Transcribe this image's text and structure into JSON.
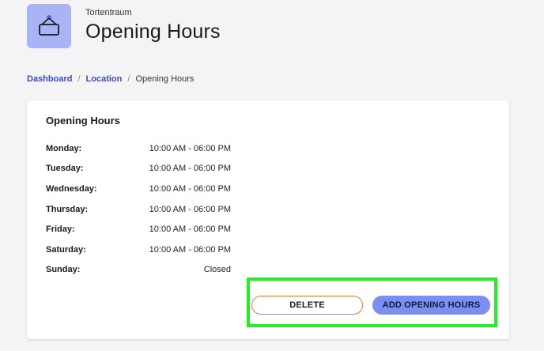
{
  "header": {
    "org_name": "Tortentraum",
    "title": "Opening Hours",
    "logo_icon": "hanging-sign-icon"
  },
  "breadcrumb": {
    "items": [
      "Dashboard",
      "Location"
    ],
    "current": "Opening Hours"
  },
  "card": {
    "title": "Opening Hours",
    "schedule": [
      {
        "day": "Monday:",
        "hours": "10:00 AM - 06:00 PM"
      },
      {
        "day": "Tuesday:",
        "hours": "10:00 AM - 06:00 PM"
      },
      {
        "day": "Wednesday:",
        "hours": "10:00 AM - 06:00 PM"
      },
      {
        "day": "Thursday:",
        "hours": "10:00 AM - 06:00 PM"
      },
      {
        "day": "Friday:",
        "hours": "10:00 AM - 06:00 PM"
      },
      {
        "day": "Saturday:",
        "hours": "10:00 AM - 06:00 PM"
      },
      {
        "day": "Sunday:",
        "hours": "Closed"
      }
    ]
  },
  "actions": {
    "delete_label": "DELETE",
    "add_label": "ADD OPENING HOURS"
  },
  "colors": {
    "accent": "#7b8ef2",
    "logo_bg": "#a8b4f5",
    "link": "#3a4ab8",
    "delete_border": "#e8763a",
    "highlight": "#22ee22"
  }
}
